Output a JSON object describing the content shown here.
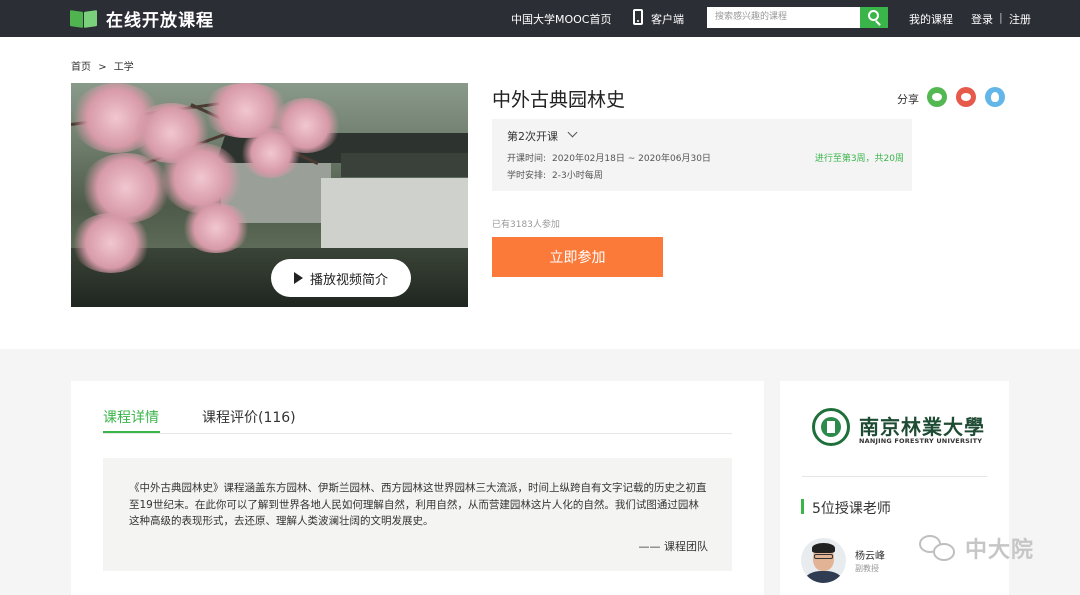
{
  "header": {
    "logo_text": "在线开放课程",
    "nav_mooc": "中国大学MOOC首页",
    "nav_client": "客户端",
    "search_placeholder": "搜索感兴趣的课程",
    "nav_my_courses": "我的课程",
    "nav_login": "登录",
    "nav_separator": "|",
    "nav_register": "注册"
  },
  "breadcrumb": {
    "home": "首页",
    "separator": ">",
    "category": "工学"
  },
  "course": {
    "title": "中外古典园林史",
    "play_label": "播放视频简介",
    "share_label": "分享",
    "share_icons": [
      "wechat-icon",
      "weibo-icon",
      "qq-icon"
    ],
    "term": {
      "name": "第2次开课",
      "dates_label": "开课时间:",
      "dates_value": "2020年02月18日 ~ 2020年06月30日",
      "hours_label": "学时安排:",
      "hours_value": "2-3小时每周",
      "progress": "进行至第3周，共20周"
    },
    "enrolled": "已有3183人参加",
    "join_label": "立即参加"
  },
  "tabs": {
    "detail": "课程详情",
    "reviews": "课程评价(116)"
  },
  "intro": {
    "text": "《中外古典园林史》课程涵盖东方园林、伊斯兰园林、西方园林这世界园林三大流派，时间上纵跨自有文字记载的历史之初直至19世纪末。在此你可以了解到世界各地人民如何理解自然，利用自然，从而营建园林这片人化的自然。我们试图通过园林这种高级的表现形式，去还原、理解人类波澜壮阔的文明发展史。",
    "signature": "—— 课程团队"
  },
  "university": {
    "name_cn": "南京林業大學",
    "name_en": "NANJING FORESTRY UNIVERSITY"
  },
  "teachers": {
    "title": "5位授课老师",
    "items": [
      {
        "name": "杨云峰",
        "role": "副教授"
      }
    ]
  },
  "watermark": {
    "text": "中大院"
  },
  "colors": {
    "brand_green": "#3ab54a",
    "join_orange": "#fb7a3a",
    "topbar": "#2b2e35"
  }
}
